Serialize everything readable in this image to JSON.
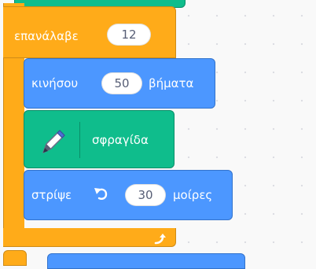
{
  "colors": {
    "motion": "#4c97ff",
    "control": "#ffab19",
    "pen": "#0fbd8c",
    "workspace": "#f9f9f9"
  },
  "repeat_block": {
    "label": "επανάλαβε",
    "count": "12",
    "end_icon": "repeat-arrow-icon"
  },
  "move_block": {
    "label": "κινήσου",
    "steps": "50",
    "unit": "βήματα"
  },
  "stamp_block": {
    "icon": "pen-icon",
    "label": "σφραγίδα"
  },
  "turn_block": {
    "label": "στρίψε",
    "icon": "rotate-left-icon",
    "degrees": "30",
    "unit": "μοίρες"
  }
}
